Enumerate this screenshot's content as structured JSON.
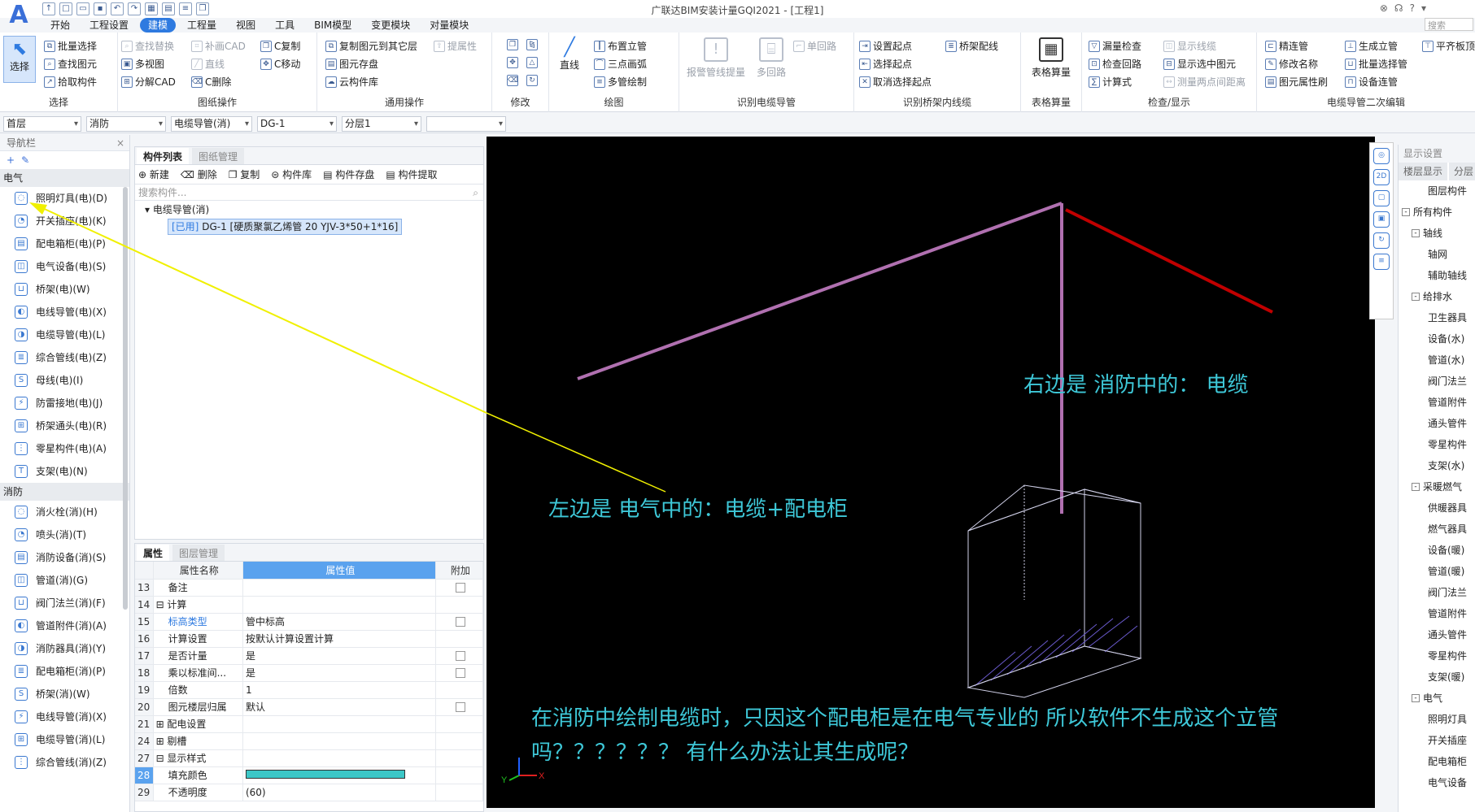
{
  "window": {
    "title": "广联达BIM安装计量GQI2021 - [工程1]",
    "search_placeholder": "搜索"
  },
  "menu_tabs": [
    "开始",
    "工程设置",
    "建模",
    "工程量",
    "视图",
    "工具",
    "BIM模型",
    "变更模块",
    "对量模块"
  ],
  "active_tab": "建模",
  "ribbon": {
    "select": {
      "label": "选择",
      "group": "选择",
      "items": [
        "批量选择",
        "查找图元",
        "拾取构件"
      ]
    },
    "drawing_ops": {
      "group": "图纸操作",
      "items": [
        "查找替换",
        "多视图",
        "分解CAD",
        "补画CAD",
        "直线",
        "C删除",
        "C复制",
        "C移动"
      ]
    },
    "general_ops": {
      "group": "通用操作",
      "items": [
        "复制图元到其它层",
        "图元存盘",
        "云构件库",
        "提属性"
      ]
    },
    "modify": {
      "group": "修改"
    },
    "draw": {
      "group": "绘图",
      "line": "直线",
      "items": [
        "布置立管",
        "三点画弧",
        "多管绘制"
      ]
    },
    "cable_ident": {
      "group": "识别电缆导管",
      "items": [
        "报警管线提量",
        "多回路",
        "单回路"
      ]
    },
    "tray_ident": {
      "group": "识别桥架内线缆",
      "items": [
        "设置起点",
        "选择起点",
        "取消选择起点",
        "桥架配线"
      ]
    },
    "table": {
      "group": "表格算量",
      "label": "表格算量"
    },
    "check": {
      "group": "检查/显示",
      "items": [
        "漏量检查",
        "检查回路",
        "计算式",
        "显示线缆",
        "显示选中图元",
        "测量两点间距离"
      ]
    },
    "edit2": {
      "group": "电缆导管二次编辑",
      "items": [
        "精连管",
        "修改名称",
        "图元属性刷",
        "生成立管",
        "批量选择管",
        "设备连管",
        "平齐板顶"
      ]
    }
  },
  "filters": {
    "floor": "首层",
    "discipline": "消防",
    "type": "电缆导管(消)",
    "component": "DG-1",
    "layer": "分层1",
    "extra": ""
  },
  "nav": {
    "title": "导航栏",
    "sections": [
      {
        "name": "电气",
        "items": [
          "照明灯具(电)(D)",
          "开关插座(电)(K)",
          "配电箱柜(电)(P)",
          "电气设备(电)(S)",
          "桥架(电)(W)",
          "电线导管(电)(X)",
          "电缆导管(电)(L)",
          "综合管线(电)(Z)",
          "母线(电)(I)",
          "防雷接地(电)(J)",
          "桥架通头(电)(R)",
          "零星构件(电)(A)",
          "支架(电)(N)"
        ]
      },
      {
        "name": "消防",
        "items": [
          "消火栓(消)(H)",
          "喷头(消)(T)",
          "消防设备(消)(S)",
          "管道(消)(G)",
          "阀门法兰(消)(F)",
          "管道附件(消)(A)",
          "消防器具(消)(Y)",
          "配电箱柜(消)(P)",
          "桥架(消)(W)",
          "电线导管(消)(X)",
          "电缆导管(消)(L)",
          "综合管线(消)(Z)"
        ]
      }
    ]
  },
  "component_panel": {
    "tabs": [
      "构件列表",
      "图纸管理"
    ],
    "tools": [
      "新建",
      "删除",
      "复制",
      "构件库",
      "构件存盘",
      "构件提取"
    ],
    "search_placeholder": "搜索构件...",
    "tree_root": "电缆导管(消)",
    "tree_item_tag": "[已用]",
    "tree_item": "DG-1 [硬质聚氯乙烯管 20 YJV-3*50+1*16]"
  },
  "properties": {
    "tabs": [
      "属性",
      "图层管理"
    ],
    "headers": [
      "属性名称",
      "属性值",
      "附加"
    ],
    "rows": [
      {
        "n": "13",
        "name": "备注",
        "value": "",
        "check": true
      },
      {
        "n": "14",
        "name": "⊟ 计算",
        "value": "",
        "check": false
      },
      {
        "n": "15",
        "name": "标高类型",
        "value": "管中标高",
        "check": true,
        "link": true
      },
      {
        "n": "16",
        "name": "计算设置",
        "value": "按默认计算设置计算",
        "check": false
      },
      {
        "n": "17",
        "name": "是否计量",
        "value": "是",
        "check": true
      },
      {
        "n": "18",
        "name": "乘以标准间...",
        "value": "是",
        "check": true
      },
      {
        "n": "19",
        "name": "倍数",
        "value": "1",
        "check": false
      },
      {
        "n": "20",
        "name": "图元楼层归属",
        "value": "默认",
        "check": true
      },
      {
        "n": "21",
        "name": "⊞ 配电设置",
        "value": "",
        "check": false
      },
      {
        "n": "24",
        "name": "⊞ 剔槽",
        "value": "",
        "check": false
      },
      {
        "n": "27",
        "name": "⊟ 显示样式",
        "value": "",
        "check": false
      },
      {
        "n": "28",
        "name": "填充颜色",
        "value": "",
        "check": false,
        "color": "#3cc7c7"
      },
      {
        "n": "29",
        "name": "不透明度",
        "value": "(60)",
        "check": false
      }
    ]
  },
  "canvas": {
    "note_right": "右边是 消防中的： 电缆",
    "note_left": "左边是  电气中的：电缆+配电柜",
    "question_line1": "在消防中绘制电缆时，只因这个配电柜是在电气专业的 所以软件不生成这个立管",
    "question_line2": "吗？？？？？？  有什么办法让其生成呢？",
    "colors": {
      "pipe": "#b070b0",
      "cable": "#c00000",
      "text": "#3ec8d8",
      "arrow": "#f0f000"
    }
  },
  "display_panel": {
    "title": "显示设置",
    "tabs": [
      "楼层显示",
      "分层"
    ],
    "rows": [
      {
        "t": "图层构件",
        "lvl": "lvl0",
        "tg": ""
      },
      {
        "t": "所有构件",
        "lvl": "lvl1",
        "tg": "-"
      },
      {
        "t": "轴线",
        "lvl": "lvl2",
        "tg": "-"
      },
      {
        "t": "轴网",
        "lvl": "lvl3",
        "tg": ""
      },
      {
        "t": "辅助轴线",
        "lvl": "lvl3",
        "tg": ""
      },
      {
        "t": "给排水",
        "lvl": "lvl2",
        "tg": "-"
      },
      {
        "t": "卫生器具",
        "lvl": "lvl3",
        "tg": ""
      },
      {
        "t": "设备(水)",
        "lvl": "lvl3",
        "tg": ""
      },
      {
        "t": "管道(水)",
        "lvl": "lvl3",
        "tg": ""
      },
      {
        "t": "阀门法兰",
        "lvl": "lvl3",
        "tg": ""
      },
      {
        "t": "管道附件",
        "lvl": "lvl3",
        "tg": ""
      },
      {
        "t": "通头管件",
        "lvl": "lvl3",
        "tg": ""
      },
      {
        "t": "零星构件",
        "lvl": "lvl3",
        "tg": ""
      },
      {
        "t": "支架(水)",
        "lvl": "lvl3",
        "tg": ""
      },
      {
        "t": "采暖燃气",
        "lvl": "lvl2",
        "tg": "-"
      },
      {
        "t": "供暖器具",
        "lvl": "lvl3",
        "tg": ""
      },
      {
        "t": "燃气器具",
        "lvl": "lvl3",
        "tg": ""
      },
      {
        "t": "设备(暖)",
        "lvl": "lvl3",
        "tg": ""
      },
      {
        "t": "管道(暖)",
        "lvl": "lvl3",
        "tg": ""
      },
      {
        "t": "阀门法兰",
        "lvl": "lvl3",
        "tg": ""
      },
      {
        "t": "管道附件",
        "lvl": "lvl3",
        "tg": ""
      },
      {
        "t": "通头管件",
        "lvl": "lvl3",
        "tg": ""
      },
      {
        "t": "零星构件",
        "lvl": "lvl3",
        "tg": ""
      },
      {
        "t": "支架(暖)",
        "lvl": "lvl3",
        "tg": ""
      },
      {
        "t": "电气",
        "lvl": "lvl2",
        "tg": "-"
      },
      {
        "t": "照明灯具",
        "lvl": "lvl3",
        "tg": ""
      },
      {
        "t": "开关插座",
        "lvl": "lvl3",
        "tg": ""
      },
      {
        "t": "配电箱柜",
        "lvl": "lvl3",
        "tg": ""
      },
      {
        "t": "电气设备",
        "lvl": "lvl3",
        "tg": ""
      }
    ]
  }
}
